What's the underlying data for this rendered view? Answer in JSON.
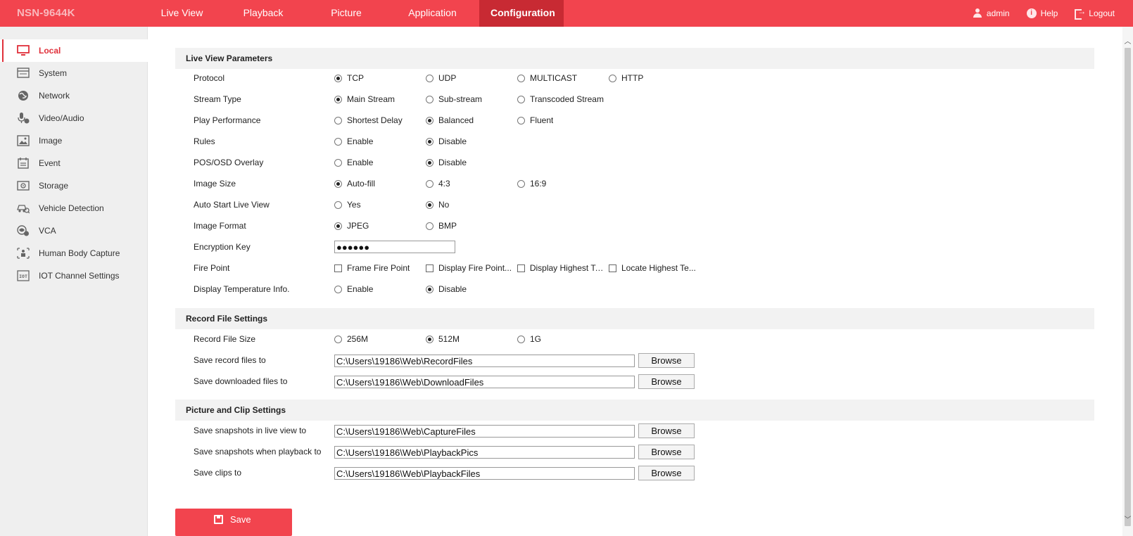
{
  "brand": "NSN-9644K",
  "nav": [
    {
      "label": "Live View"
    },
    {
      "label": "Playback"
    },
    {
      "label": "Picture"
    },
    {
      "label": "Application"
    },
    {
      "label": "Configuration",
      "active": true
    }
  ],
  "user": {
    "name": "admin",
    "help": "Help",
    "logout": "Logout"
  },
  "colors": {
    "accent": "#f2444e",
    "accent_dark": "#c82a33",
    "active_text": "#e0303a"
  },
  "sidebar": {
    "items": [
      {
        "label": "Local",
        "icon": "monitor-icon",
        "active": true
      },
      {
        "label": "System",
        "icon": "system-icon"
      },
      {
        "label": "Network",
        "icon": "globe-icon"
      },
      {
        "label": "Video/Audio",
        "icon": "microphone-icon"
      },
      {
        "label": "Image",
        "icon": "image-icon"
      },
      {
        "label": "Event",
        "icon": "calendar-icon"
      },
      {
        "label": "Storage",
        "icon": "disk-icon"
      },
      {
        "label": "Vehicle Detection",
        "icon": "vehicle-icon"
      },
      {
        "label": "VCA",
        "icon": "vca-icon"
      },
      {
        "label": "Human Body Capture",
        "icon": "human-body-icon"
      },
      {
        "label": "IOT Channel Settings",
        "icon": "iot-icon"
      }
    ]
  },
  "sections": {
    "live_view": {
      "title": "Live View Parameters",
      "protocol": {
        "label": "Protocol",
        "options": [
          "TCP",
          "UDP",
          "MULTICAST",
          "HTTP"
        ],
        "selected": "TCP"
      },
      "stream_type": {
        "label": "Stream Type",
        "options": [
          "Main Stream",
          "Sub-stream",
          "Transcoded Stream"
        ],
        "selected": "Main Stream"
      },
      "play_performance": {
        "label": "Play Performance",
        "options": [
          "Shortest Delay",
          "Balanced",
          "Fluent"
        ],
        "selected": "Balanced"
      },
      "rules": {
        "label": "Rules",
        "options": [
          "Enable",
          "Disable"
        ],
        "selected": "Disable"
      },
      "pos_osd": {
        "label": "POS/OSD Overlay",
        "options": [
          "Enable",
          "Disable"
        ],
        "selected": "Disable"
      },
      "image_size": {
        "label": "Image Size",
        "options": [
          "Auto-fill",
          "4:3",
          "16:9"
        ],
        "selected": "Auto-fill"
      },
      "auto_start": {
        "label": "Auto Start Live View",
        "options": [
          "Yes",
          "No"
        ],
        "selected": "No"
      },
      "image_format": {
        "label": "Image Format",
        "options": [
          "JPEG",
          "BMP"
        ],
        "selected": "JPEG"
      },
      "encryption_key": {
        "label": "Encryption Key",
        "value": "●●●●●●"
      },
      "fire_point": {
        "label": "Fire Point",
        "options": [
          "Frame Fire Point",
          "Display Fire Point...",
          "Display Highest Te...",
          "Locate Highest Te..."
        ]
      },
      "display_temp": {
        "label": "Display Temperature Info.",
        "options": [
          "Enable",
          "Disable"
        ],
        "selected": "Disable"
      }
    },
    "record_file": {
      "title": "Record File Settings",
      "file_size": {
        "label": "Record File Size",
        "options": [
          "256M",
          "512M",
          "1G"
        ],
        "selected": "512M"
      },
      "save_record": {
        "label": "Save record files to",
        "value": "C:\\Users\\19186\\Web\\RecordFiles"
      },
      "save_downloaded": {
        "label": "Save downloaded files to",
        "value": "C:\\Users\\19186\\Web\\DownloadFiles"
      }
    },
    "picture_clip": {
      "title": "Picture and Clip Settings",
      "snap_live": {
        "label": "Save snapshots in live view to",
        "value": "C:\\Users\\19186\\Web\\CaptureFiles"
      },
      "snap_playback": {
        "label": "Save snapshots when playback to",
        "value": "C:\\Users\\19186\\Web\\PlaybackPics"
      },
      "clips": {
        "label": "Save clips to",
        "value": "C:\\Users\\19186\\Web\\PlaybackFiles"
      }
    }
  },
  "browse_label": "Browse",
  "save_label": "Save"
}
